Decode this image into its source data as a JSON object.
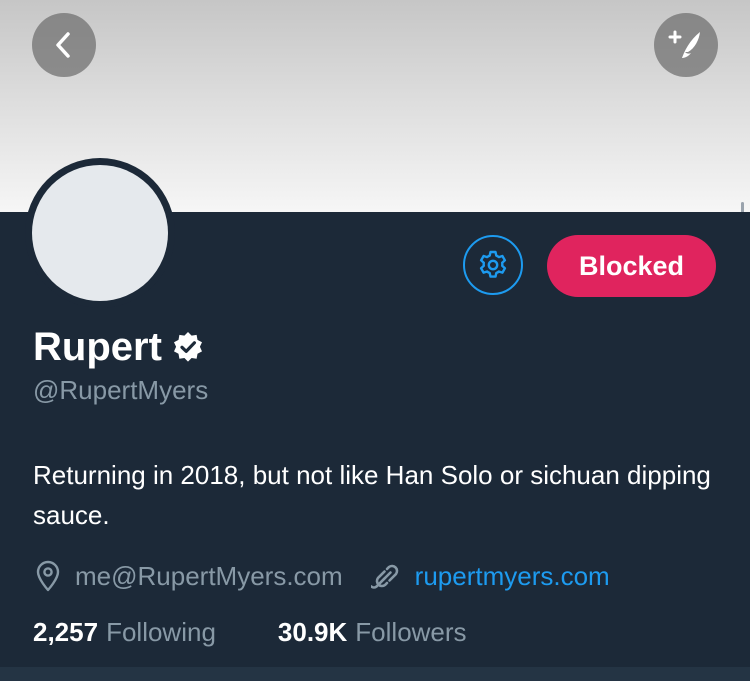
{
  "header": {
    "back_icon": "chevron-left-icon",
    "compose_icon": "compose-tweet-icon"
  },
  "profile": {
    "name": "Rupert",
    "handle": "@RupertMyers",
    "verified_icon": "verified-badge-icon",
    "bio": "Returning in 2018, but not like Han Solo or sichuan dipping sauce.",
    "email": "me@RupertMyers.com",
    "website": "rupertmyers.com"
  },
  "actions": {
    "settings_icon": "gear-icon",
    "blocked_label": "Blocked"
  },
  "stats": {
    "following_count": "2,257",
    "following_label": "Following",
    "followers_count": "30.9K",
    "followers_label": "Followers"
  },
  "colors": {
    "background": "#1c2938",
    "accent": "#1d9bf0",
    "blocked": "#e0245e",
    "secondary_text": "#8899a6"
  }
}
